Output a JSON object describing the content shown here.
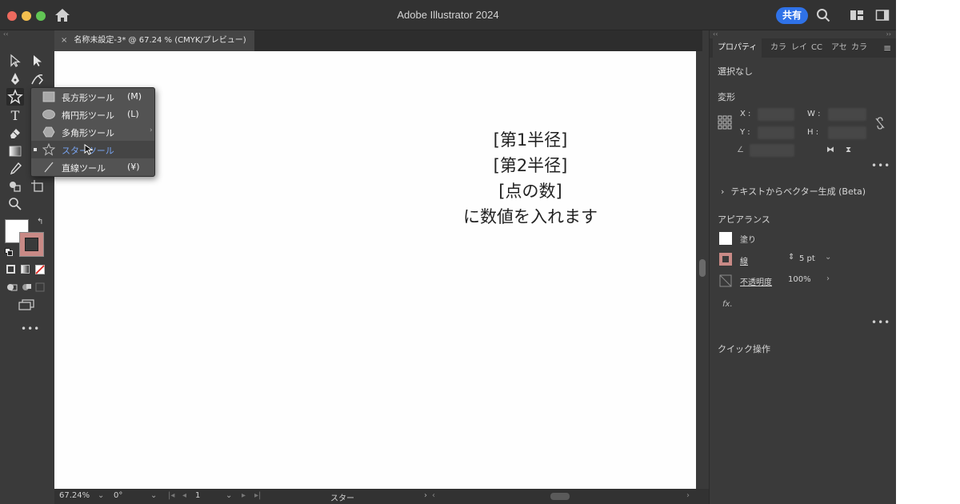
{
  "app": {
    "title": "Adobe Illustrator 2024",
    "share_label": "共有"
  },
  "document": {
    "tab_label": "名称未設定-3* @ 67.24 % (CMYK/プレビュー)"
  },
  "tool_popup": {
    "items": [
      {
        "label": "長方形ツール",
        "key": "(M)",
        "icon": "rectangle-icon"
      },
      {
        "label": "楕円形ツール",
        "key": "(L)",
        "icon": "ellipse-icon"
      },
      {
        "label": "多角形ツール",
        "key": "",
        "icon": "polygon-icon"
      },
      {
        "label": "スターツール",
        "key": "",
        "icon": "star-icon",
        "selected": true
      },
      {
        "label": "直線ツール",
        "key": "(¥)",
        "icon": "line-icon"
      }
    ]
  },
  "canvas": {
    "lines": [
      "[第1半径]",
      "[第2半径]",
      "[点の数]",
      "に数値を入れます"
    ]
  },
  "status": {
    "zoom": "67.24%",
    "rotation": "0°",
    "page": "1",
    "tool": "スター"
  },
  "panel": {
    "tabs": [
      "プロパティ",
      "カラ",
      "レイ",
      "CC",
      "アセ",
      "カラ"
    ],
    "selection": "選択なし",
    "transform": {
      "title": "変形",
      "x_label": "X :",
      "y_label": "Y :",
      "w_label": "W :",
      "h_label": "H :"
    },
    "text_to_vector": "テキストからベクター生成 (Beta)",
    "appearance": {
      "title": "アピアランス",
      "fill_label": "塗り",
      "stroke_label": "線",
      "stroke_weight": "5 pt",
      "opacity_label": "不透明度",
      "opacity_value": "100%",
      "fx_label": "fx."
    },
    "quick_actions": "クイック操作"
  },
  "colors": {
    "accent": "#2f72e8",
    "stroke_swatch": "#c98a86",
    "canvas": "#fefefe"
  }
}
